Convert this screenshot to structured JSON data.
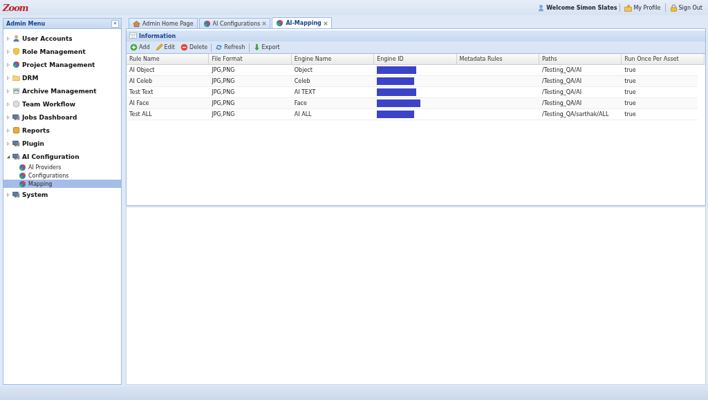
{
  "header": {
    "logo": "Zoom",
    "welcome": "Welcome Simon Slates",
    "links": [
      {
        "label": "My Profile",
        "kind": "profile"
      },
      {
        "label": "Sign Out",
        "kind": "lock"
      }
    ]
  },
  "sidebar": {
    "title": "Admin Menu",
    "collapse": "«",
    "items": [
      {
        "label": "User Accounts",
        "kind": "user",
        "expanded": false,
        "selected": false
      },
      {
        "label": "Role Management",
        "kind": "shield",
        "expanded": false,
        "selected": false
      },
      {
        "label": "Project Management",
        "kind": "ball",
        "expanded": false,
        "selected": false
      },
      {
        "label": "DRM",
        "kind": "folder",
        "expanded": false,
        "selected": false
      },
      {
        "label": "Archive Management",
        "kind": "archive",
        "expanded": false,
        "selected": false
      },
      {
        "label": "Team Workflow",
        "kind": "cube",
        "expanded": false,
        "selected": false
      },
      {
        "label": "Jobs Dashboard",
        "kind": "monitor",
        "expanded": false,
        "selected": false
      },
      {
        "label": "Reports",
        "kind": "report",
        "expanded": false,
        "selected": false
      },
      {
        "label": "Plugin",
        "kind": "monitor",
        "expanded": false,
        "selected": false
      },
      {
        "label": "AI Configuration",
        "kind": "monitor",
        "expanded": true,
        "selected": false,
        "children": [
          {
            "label": "AI Providers",
            "kind": "ball",
            "selected": false
          },
          {
            "label": "Configurations",
            "kind": "ball",
            "selected": false
          },
          {
            "label": "Mapping",
            "kind": "ball",
            "selected": true
          }
        ]
      },
      {
        "label": "System",
        "kind": "monitor",
        "expanded": false,
        "selected": false
      }
    ]
  },
  "tabs": [
    {
      "label": "Admin Home Page",
      "kind": "home",
      "closable": false,
      "selected": false
    },
    {
      "label": "AI Configurations",
      "kind": "ball",
      "closable": true,
      "selected": false
    },
    {
      "label": "AI-Mapping",
      "kind": "ball",
      "closable": true,
      "selected": true
    }
  ],
  "panel": {
    "title": "Information",
    "toolbar": [
      {
        "label": "Add",
        "kind": "add"
      },
      {
        "label": "Edit",
        "kind": "edit"
      },
      {
        "label": "Delete",
        "kind": "delete"
      },
      {
        "label": "Refresh",
        "kind": "refresh"
      },
      {
        "label": "Export",
        "kind": "export"
      }
    ],
    "table": {
      "columns": [
        "Rule Name",
        "File Format",
        "Engine Name",
        "Engine ID",
        "Metadata Rules",
        "Paths",
        "Run Once Per Asset"
      ],
      "rows": [
        {
          "rule_name": "AI Object",
          "file_format": "JPG,PNG",
          "engine_name": "Object",
          "engine_id_redacted": true,
          "paths": "/Testing_QA/AI",
          "run_once": "true"
        },
        {
          "rule_name": "AI Celeb",
          "file_format": "JPG,PNG",
          "engine_name": "Celeb",
          "engine_id_redacted": true,
          "paths": "/Testing_QA/AI",
          "run_once": "true"
        },
        {
          "rule_name": "Test Text",
          "file_format": "JPG,PNG",
          "engine_name": "AI TEXT",
          "engine_id_redacted": true,
          "paths": "/Testing_QA/AI",
          "run_once": "true"
        },
        {
          "rule_name": "AI Face",
          "file_format": "JPG,PNG",
          "engine_name": "Face",
          "engine_id_redacted": true,
          "paths": "/Testing_QA/AI",
          "run_once": "true"
        },
        {
          "rule_name": "Test ALL",
          "file_format": "JPG,PNG",
          "engine_name": "AI ALL",
          "engine_id_redacted": true,
          "paths": "/Testing_QA/sarthak/ALL",
          "run_once": "true"
        }
      ]
    }
  }
}
